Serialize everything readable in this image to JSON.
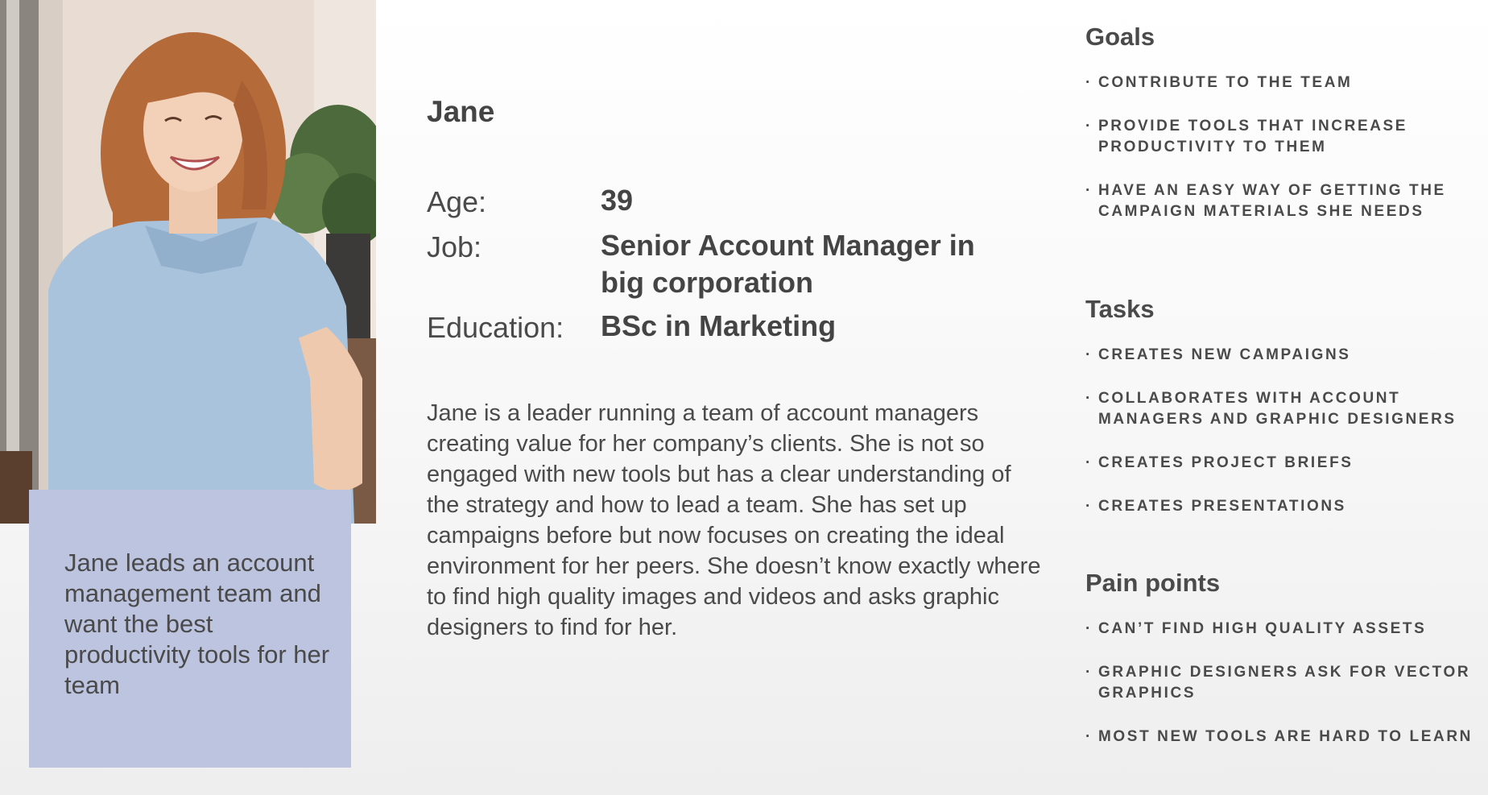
{
  "persona": {
    "name": "Jane",
    "photo_icon": "persona-photo",
    "quote": "Jane leads an account management team and want the best productivity tools for her team",
    "facts": {
      "age_label": "Age:",
      "age_value": "39",
      "job_label": "Job:",
      "job_value": "Senior Account Manager in big corporation",
      "education_label": "Education:",
      "education_value": "BSc in Marketing"
    },
    "bio": "Jane is a leader running a team of account managers creating value for her company’s clients. She is not so engaged with new tools but has a clear understanding of the strategy and how to lead a team. She has set up campaigns before but now focuses on creating the ideal environment for her peers. She doesn’t know exactly where to find high quality images and videos and asks graphic designers to find for her."
  },
  "sections": {
    "goals": {
      "title": "Goals",
      "items": [
        "CONTRIBUTE TO THE TEAM",
        "PROVIDE TOOLS THAT INCREASE PRODUCTIVITY TO THEM",
        "HAVE AN EASY WAY OF GETTING THE CAMPAIGN MATERIALS SHE NEEDS"
      ]
    },
    "tasks": {
      "title": "Tasks",
      "items": [
        "CREATES NEW CAMPAIGNS",
        "COLLABORATES WITH ACCOUNT MANAGERS AND GRAPHIC DESIGNERS",
        "CREATES PROJECT BRIEFS",
        "CREATES PRESENTATIONS"
      ]
    },
    "pain_points": {
      "title": "Pain points",
      "items": [
        "CAN’T FIND HIGH QUALITY ASSETS",
        "GRAPHIC DESIGNERS ASK FOR VECTOR GRAPHICS",
        "MOST NEW TOOLS ARE HARD TO LEARN"
      ]
    }
  },
  "colors": {
    "quote_card": "#bcc4e0",
    "text": "#4a4a4a"
  }
}
